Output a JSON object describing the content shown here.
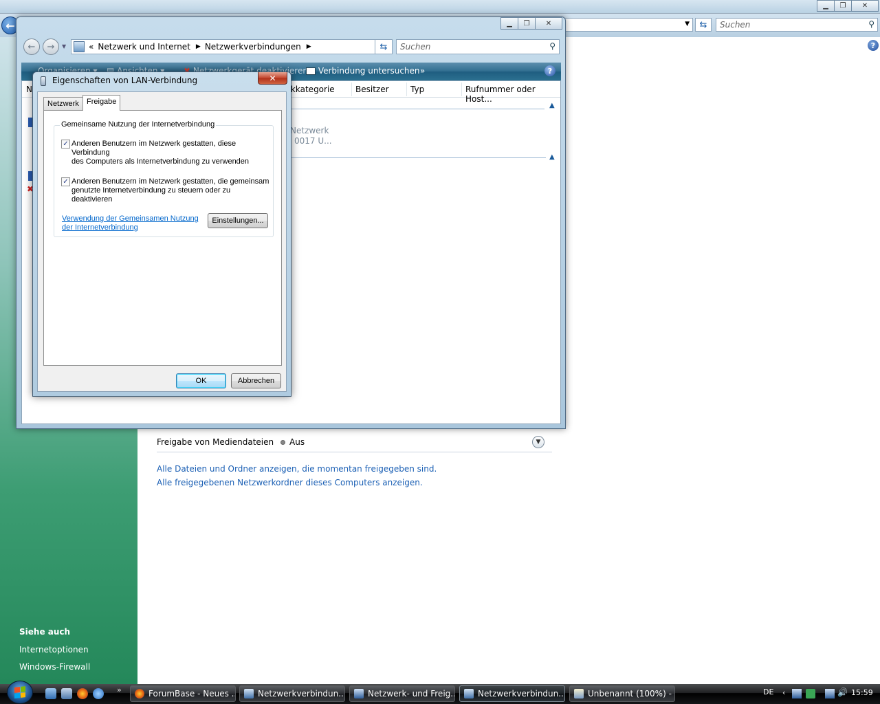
{
  "background_window": {
    "search_placeholder": "Suchen",
    "help_label": "?",
    "media_sharing": {
      "label": "Freigabe von Mediendateien",
      "value": "Aus"
    },
    "links": [
      "Alle Dateien und Ordner anzeigen, die momentan freigegeben sind.",
      "Alle freigegebenen Netzwerkordner dieses Computers anzeigen."
    ],
    "sidebar": {
      "heading": "Siehe auch",
      "items": [
        "Internetoptionen",
        "Windows-Firewall"
      ]
    }
  },
  "connections_window": {
    "breadcrumb_prefix": "«",
    "breadcrumbs": [
      "Netzwerk und Internet",
      "Netzwerkverbindungen"
    ],
    "search_placeholder": "Suchen",
    "toolbar": {
      "organize": "Organisieren",
      "views": "Ansichten",
      "disable": "Netzwerkgerät deaktivieren",
      "diagnose": "Verbindung untersuchen",
      "more": "»"
    },
    "columns": [
      "N",
      "rkkategorie",
      "Besitzer",
      "Typ",
      "Rufnummer oder Host..."
    ],
    "faded_item": [
      "Netzwerk",
      "0017 U..."
    ],
    "help_label": "?"
  },
  "dialog": {
    "title": "Eigenschaften von LAN-Verbindung",
    "close_label": "✕",
    "tabs": [
      "Netzwerk",
      "Freigabe"
    ],
    "active_tab": "Freigabe",
    "group_label": "Gemeinsame Nutzung der Internetverbindung",
    "checkbox1": {
      "line1": "Anderen Benutzern im Netzwerk gestatten, diese Verbindung",
      "line2": "des Computers als Internetverbindung zu verwenden",
      "checked": true
    },
    "checkbox2": {
      "line1": "Anderen Benutzern im Netzwerk gestatten, die gemeinsam",
      "line2": "genutzte Internetverbindung zu steuern oder zu deaktivieren",
      "checked": true
    },
    "link_line1": "Verwendung der Gemeinsamen Nutzung",
    "link_line2": "der Internetverbindung",
    "settings_button": "Einstellungen...",
    "ok_button": "OK",
    "cancel_button": "Abbrechen"
  },
  "taskbar": {
    "tasks": [
      {
        "label": "ForumBase - Neues ...",
        "icon": "firefox-icon",
        "active": false
      },
      {
        "label": "Netzwerkverbindun...",
        "icon": "network-connections-icon",
        "active": false
      },
      {
        "label": "Netzwerk- und Freig...",
        "icon": "network-center-icon",
        "active": false
      },
      {
        "label": "Netzwerkverbindun...",
        "icon": "network-connections-icon",
        "active": true
      },
      {
        "label": "Unbenannt (100%) - ...",
        "icon": "paint-icon",
        "active": false
      }
    ],
    "more_label": "»",
    "language": "DE",
    "tray_expand": "‹",
    "clock": "15:59"
  },
  "colors": {
    "link": "#1a5fb4",
    "toolbar_blue": "#2f6d8f",
    "sidebar_green": "#3d9d73",
    "close_red": "#c4472f"
  }
}
